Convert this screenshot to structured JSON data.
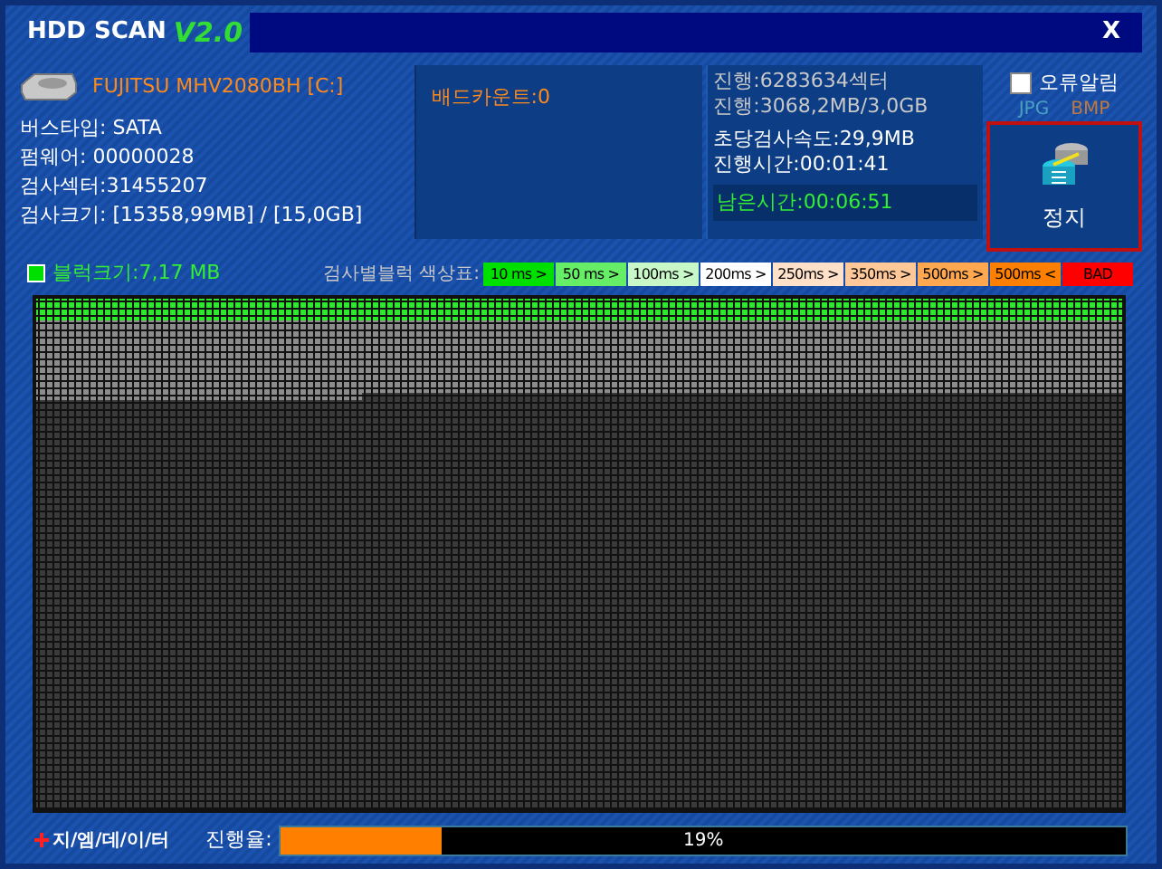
{
  "window": {
    "title": "HDD SCAN",
    "version": "V2.0",
    "close": "X"
  },
  "drive": {
    "name": "FUJITSU MHV2080BH [C:]"
  },
  "info": [
    "버스타입: SATA",
    "펌웨어: 00000028",
    "검사섹터:31455207",
    "검사크기: [15358,99MB] / [15,0GB]"
  ],
  "bad_count": "배드카운트:0",
  "progress_info": [
    "진행:6283634섹터",
    "진행:3068,2MB/3,0GB"
  ],
  "speed": "초당검사속도:29,9MB",
  "elapsed": "진행시간:00:01:41",
  "remaining": "남은시간:00:06:51",
  "error_alert": {
    "label": "오류알림",
    "checked": false
  },
  "formats": [
    {
      "label": "JPG",
      "color": "#4aa0c0"
    },
    {
      "label": "BMP",
      "color": "#c07a40"
    }
  ],
  "stop_button": "정지",
  "block_size": "블럭크기:7,17 MB",
  "legend_title": "검사별블럭 색상표:",
  "legend": [
    {
      "label": "10 ms >",
      "color": "#00e000"
    },
    {
      "label": "50 ms >",
      "color": "#66ee66"
    },
    {
      "label": "100ms >",
      "color": "#c8f8c8"
    },
    {
      "label": "200ms >",
      "color": "#ffffff"
    },
    {
      "label": "250ms >",
      "color": "#ffe0c8"
    },
    {
      "label": "350ms >",
      "color": "#ffc898"
    },
    {
      "label": "500ms >",
      "color": "#ffa850"
    },
    {
      "label": "500ms <",
      "color": "#ff8000"
    },
    {
      "label": "BAD",
      "color": "#ff0000"
    }
  ],
  "brand": "지/엠/데/이/터",
  "progress": {
    "label": "진행율:",
    "level": 0.19,
    "reading": "19%"
  }
}
